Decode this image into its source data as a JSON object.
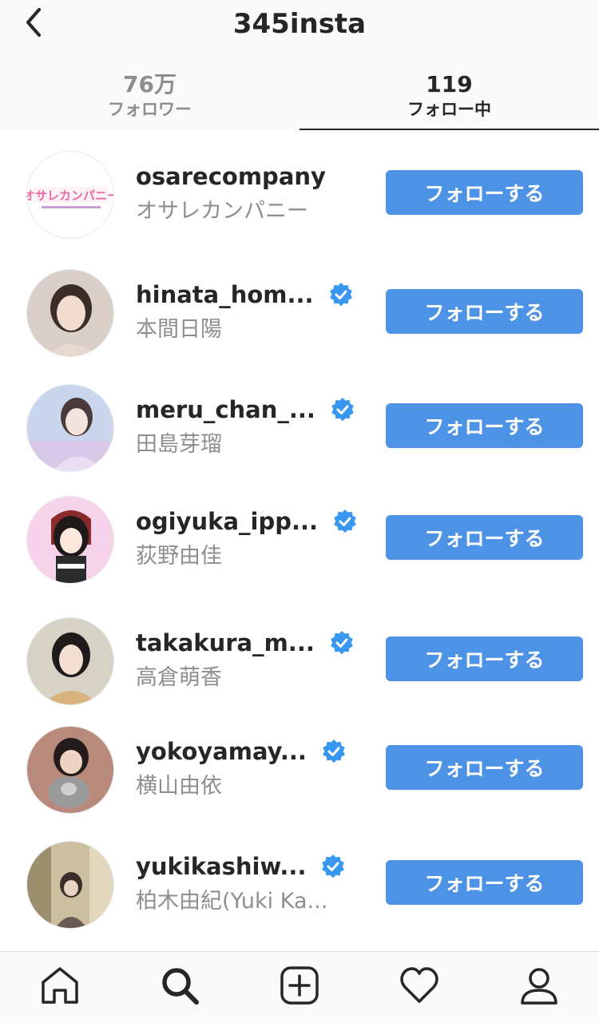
{
  "header": {
    "title": "345insta",
    "back_icon": "chevron-left-icon"
  },
  "tabs": [
    {
      "count": "76万",
      "label": "フォロワー",
      "active": false
    },
    {
      "count": "119",
      "label": "フォロー中",
      "active": true
    }
  ],
  "accent_color": "#4c93e6",
  "verified_color": "#3897f0",
  "follow_label": "フォローする",
  "accounts": [
    {
      "username": "osarecompany",
      "fullname": "オサレカンパニー",
      "verified": false,
      "avatar_logo_text": "オサレカンパニー"
    },
    {
      "username": "hinata_hom...",
      "fullname": "本間日陽",
      "verified": true
    },
    {
      "username": "meru_chan_...",
      "fullname": "田島芽瑠",
      "verified": true
    },
    {
      "username": "ogiyuka_ipp...",
      "fullname": "荻野由佳",
      "verified": true
    },
    {
      "username": "takakura_m...",
      "fullname": "高倉萌香",
      "verified": true
    },
    {
      "username": "yokoyamay...",
      "fullname": "横山由依",
      "verified": true
    },
    {
      "username": "yukikashiw...",
      "fullname": "柏木由紀(Yuki Ka...",
      "verified": true
    }
  ],
  "bottom_nav": [
    {
      "icon": "home-icon"
    },
    {
      "icon": "search-icon"
    },
    {
      "icon": "add-post-icon"
    },
    {
      "icon": "heart-icon"
    },
    {
      "icon": "profile-icon"
    }
  ]
}
